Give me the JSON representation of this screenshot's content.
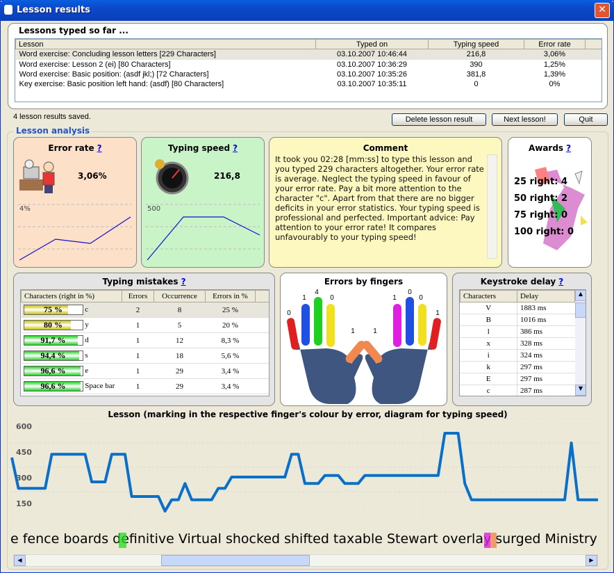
{
  "window": {
    "title": "Lesson results",
    "close_symbol": "✕"
  },
  "lessons": {
    "group_title": "Lessons typed so far ...",
    "columns": [
      "Lesson",
      "Typed on",
      "Typing speed",
      "Error rate"
    ],
    "rows": [
      [
        "Word exercise: Concluding lesson letters [229 Characters]",
        "03.10.2007 10:46:44",
        "216,8",
        "3,06%"
      ],
      [
        "Word exercise: Lesson  2 (ei) [80 Characters]",
        "03.10.2007 10:36:29",
        "390",
        "1,25%"
      ],
      [
        "Word exercise: Basic position: (asdf jkl;) [72 Characters]",
        "03.10.2007 10:35:26",
        "381,8",
        "1,39%"
      ],
      [
        "Key exercise: Basic position left hand: (asdf) [80 Characters]",
        "03.10.2007 10:35:11",
        "0",
        "0%"
      ]
    ],
    "status": "4 lesson results saved."
  },
  "buttons": {
    "delete": "Delete lesson result",
    "next": "Next lesson!",
    "quit": "Quit"
  },
  "analysis": {
    "section_title": "Lesson analysis",
    "help_mark": "?",
    "error_rate": {
      "title": "Error rate",
      "value": "3,06%",
      "axis_label": "4%"
    },
    "typing_speed": {
      "title": "Typing speed",
      "value": "216,8",
      "axis_label": "500"
    },
    "comment": {
      "title": "Comment",
      "text": "It took you 02:28 [mm:ss] to type this lesson and you typed 229 characters altogether. Your error rate is average. Neglect the typing speed in favour of your error rate. Pay a bit more attention to the character \"c\". Apart from that there are no bigger deficits in your error statistics. Your typing speed is professional and perfected. Important advice: Pay attention to your error rate! It compares unfavourably to your typing speed!"
    },
    "awards": {
      "title": "Awards",
      "lines": [
        "25 right: 4",
        "50 right: 2",
        "75 right: 0",
        "100 right: 0"
      ]
    }
  },
  "mistakes": {
    "title": "Typing mistakes",
    "columns": [
      "Characters (right in %)",
      "Errors",
      "Occurrence",
      "Errors in %"
    ],
    "rows": [
      {
        "pct": "75 %",
        "level": 0.75,
        "char": "c",
        "errors": "2",
        "occ": "8",
        "errpct": "25 %",
        "color": "#c8c000"
      },
      {
        "pct": "80 %",
        "level": 0.8,
        "char": "y",
        "errors": "1",
        "occ": "5",
        "errpct": "20 %",
        "color": "#c8c000"
      },
      {
        "pct": "91,7 %",
        "level": 0.917,
        "char": "d",
        "errors": "1",
        "occ": "12",
        "errpct": "8,3 %",
        "color": "#22cc22"
      },
      {
        "pct": "94,4 %",
        "level": 0.944,
        "char": "s",
        "errors": "1",
        "occ": "18",
        "errpct": "5,6 %",
        "color": "#22cc22"
      },
      {
        "pct": "96,6 %",
        "level": 0.966,
        "char": "e",
        "errors": "1",
        "occ": "29",
        "errpct": "3,4 %",
        "color": "#22cc22"
      },
      {
        "pct": "96,6 %",
        "level": 0.966,
        "char": "Space bar",
        "errors": "1",
        "occ": "29",
        "errpct": "3,4 %",
        "color": "#22cc22"
      }
    ]
  },
  "fingers": {
    "title": "Errors by fingers",
    "left": [
      "0",
      "1",
      "4",
      "0",
      "1"
    ],
    "right": [
      "1",
      "1",
      "0",
      "0",
      "1"
    ]
  },
  "keystroke": {
    "title": "Keystroke delay",
    "columns": [
      "Characters",
      "Delay"
    ],
    "rows": [
      [
        "V",
        "1883 ms"
      ],
      [
        "B",
        "1016 ms"
      ],
      [
        "l",
        "386 ms"
      ],
      [
        "x",
        "328 ms"
      ],
      [
        "i",
        "324 ms"
      ],
      [
        "k",
        "297 ms"
      ],
      [
        "E",
        "297 ms"
      ],
      [
        "c",
        "287 ms"
      ]
    ]
  },
  "lesson_chart": {
    "title": "Lesson (marking in the respective finger's colour by error, diagram for typing speed)",
    "y_ticks": [
      "600",
      "450",
      "300",
      "150"
    ],
    "text_line": "e fence boards definitive Virtual shocked shifted taxable Stewart overlay surged Ministry",
    "marked_1": "de",
    "marked_2": "ay"
  },
  "chart_data": {
    "type": "line",
    "title": "Lesson (marking in the respective finger's colour by error, diagram for typing speed)",
    "ylim": [
      0,
      600
    ],
    "y_ticks": [
      600,
      450,
      300,
      150
    ],
    "values": [
      360,
      170,
      170,
      170,
      170,
      170,
      380,
      380,
      380,
      380,
      380,
      380,
      210,
      210,
      210,
      380,
      380,
      380,
      120,
      120,
      120,
      120,
      120,
      30,
      100,
      100,
      200,
      100,
      100,
      100,
      100,
      170,
      170,
      240,
      240,
      240,
      240,
      240,
      240,
      240,
      240,
      240,
      380,
      380,
      200,
      200,
      200,
      250,
      250,
      250,
      200,
      200,
      200,
      250,
      250,
      250,
      250,
      250,
      250,
      250,
      250,
      250,
      250,
      250,
      250,
      510,
      510,
      510,
      200,
      100,
      100,
      100,
      100,
      100,
      100,
      100,
      100,
      100,
      100,
      100,
      100,
      100,
      100,
      100,
      450,
      100,
      100,
      100,
      100
    ]
  },
  "colors": {
    "accent": "#1f55c8",
    "line": "#0a6fc8",
    "error_bg": "#fde0c8",
    "speed_bg": "#c8f4c8",
    "comment_bg": "#fcf8c0"
  }
}
